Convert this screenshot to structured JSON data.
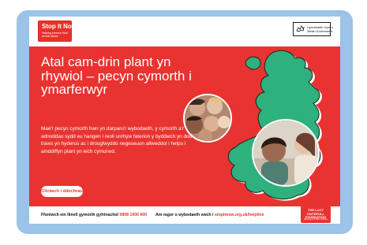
{
  "header": {
    "stop_logo_title": "Stop It Now!",
    "stop_logo_tagline": "Helping prevent child sexual abuse",
    "gov_line1": "Llywodraeth Cymru",
    "gov_line2": "Welsh Government"
  },
  "hero": {
    "title": "Atal cam-drin plant yn rhywiol – pecyn cymorth i ymarferwyr",
    "body": "Mae'r pecyn cymorth hwn yn darparu'r wybodaeth, y cymorth a'r adnoddau sydd eu hangen i reoli unrhyw faterion y byddwch yn dod ar eu traws yn hyderus ac i drosglwyddo negeseuon allweddol i helpu i amddiffyn plant yn eich cymuned.",
    "cta_label": "Cliciwch i ddechrau"
  },
  "footer": {
    "helpline_text": "Ffoniwch ein llinell gymorth gyfrinachol",
    "helpline_number": "0808 1000 900",
    "more_info_text": "Am ragor o wybodaeth ewch i",
    "website": "stopitnow.org.uk/helpline",
    "lff_logo_name": "THE LUCY FAITHFULL FOUNDATION",
    "lff_logo_tagline": "Working to protect children"
  },
  "colors": {
    "frame": "#9cc3e8",
    "hero_red": "#e93330",
    "map_green": "#2eb17d"
  }
}
